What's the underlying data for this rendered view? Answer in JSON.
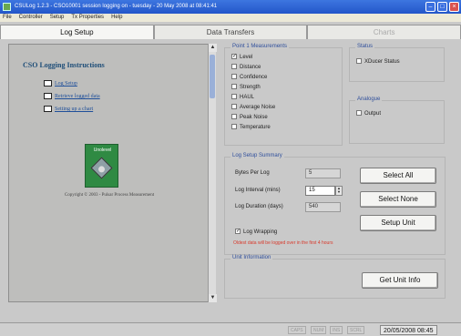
{
  "window": {
    "title": "CSULog 1.2.3 - CSO10001 session logging on - tuesday - 20 May 2008 at 08:41:41"
  },
  "menu": [
    "File",
    "Controller",
    "Setup",
    "Tx Properties",
    "Help"
  ],
  "tabs": [
    {
      "label": "Log Setup",
      "state": "active"
    },
    {
      "label": "Data Transfers",
      "state": "normal"
    },
    {
      "label": "Charts",
      "state": "disabled"
    }
  ],
  "left_panel": {
    "title": "CSO Logging Instructions",
    "links": [
      "Log Setup",
      "Retrieve logged data",
      "Setting up a chart"
    ],
    "product_label": "Unolevel",
    "copyright": "Copyright © 2003 - Pulsar Process Measurement"
  },
  "measurements": {
    "legend": "Point 1 Measurements",
    "items": [
      {
        "label": "Level",
        "checked": true
      },
      {
        "label": "Distance",
        "checked": false
      },
      {
        "label": "Confidence",
        "checked": false
      },
      {
        "label": "Strength",
        "checked": false
      },
      {
        "label": "HAUL",
        "checked": false
      },
      {
        "label": "Average Noise",
        "checked": false
      },
      {
        "label": "Peak Noise",
        "checked": false
      },
      {
        "label": "Temperature",
        "checked": false
      }
    ]
  },
  "status_box": {
    "legend": "Status",
    "items": [
      {
        "label": "XDucer Status",
        "checked": false
      }
    ]
  },
  "analogue_box": {
    "legend": "Analogue",
    "items": [
      {
        "label": "Output",
        "checked": false
      }
    ]
  },
  "log_summary": {
    "legend": "Log Setup Summary",
    "bytes_label": "Bytes Per Log",
    "bytes_value": "5",
    "interval_label": "Log Interval (mins)",
    "interval_value": "15",
    "duration_label": "Log Duration (days)",
    "duration_value": "540",
    "wrapping_label": "Log Wrapping",
    "wrapping_checked": true,
    "warning": "Oldest data will be logged over in the first 4 hours",
    "select_all": "Select All",
    "select_none": "Select None",
    "setup_unit": "Setup Unit"
  },
  "unit_info": {
    "legend": "Unit Information",
    "button": "Get Unit Info"
  },
  "statusbar": {
    "keys": [
      "CAPS",
      "NUM",
      "INS",
      "SCRL"
    ],
    "datetime": "20/05/2008 08:45"
  }
}
